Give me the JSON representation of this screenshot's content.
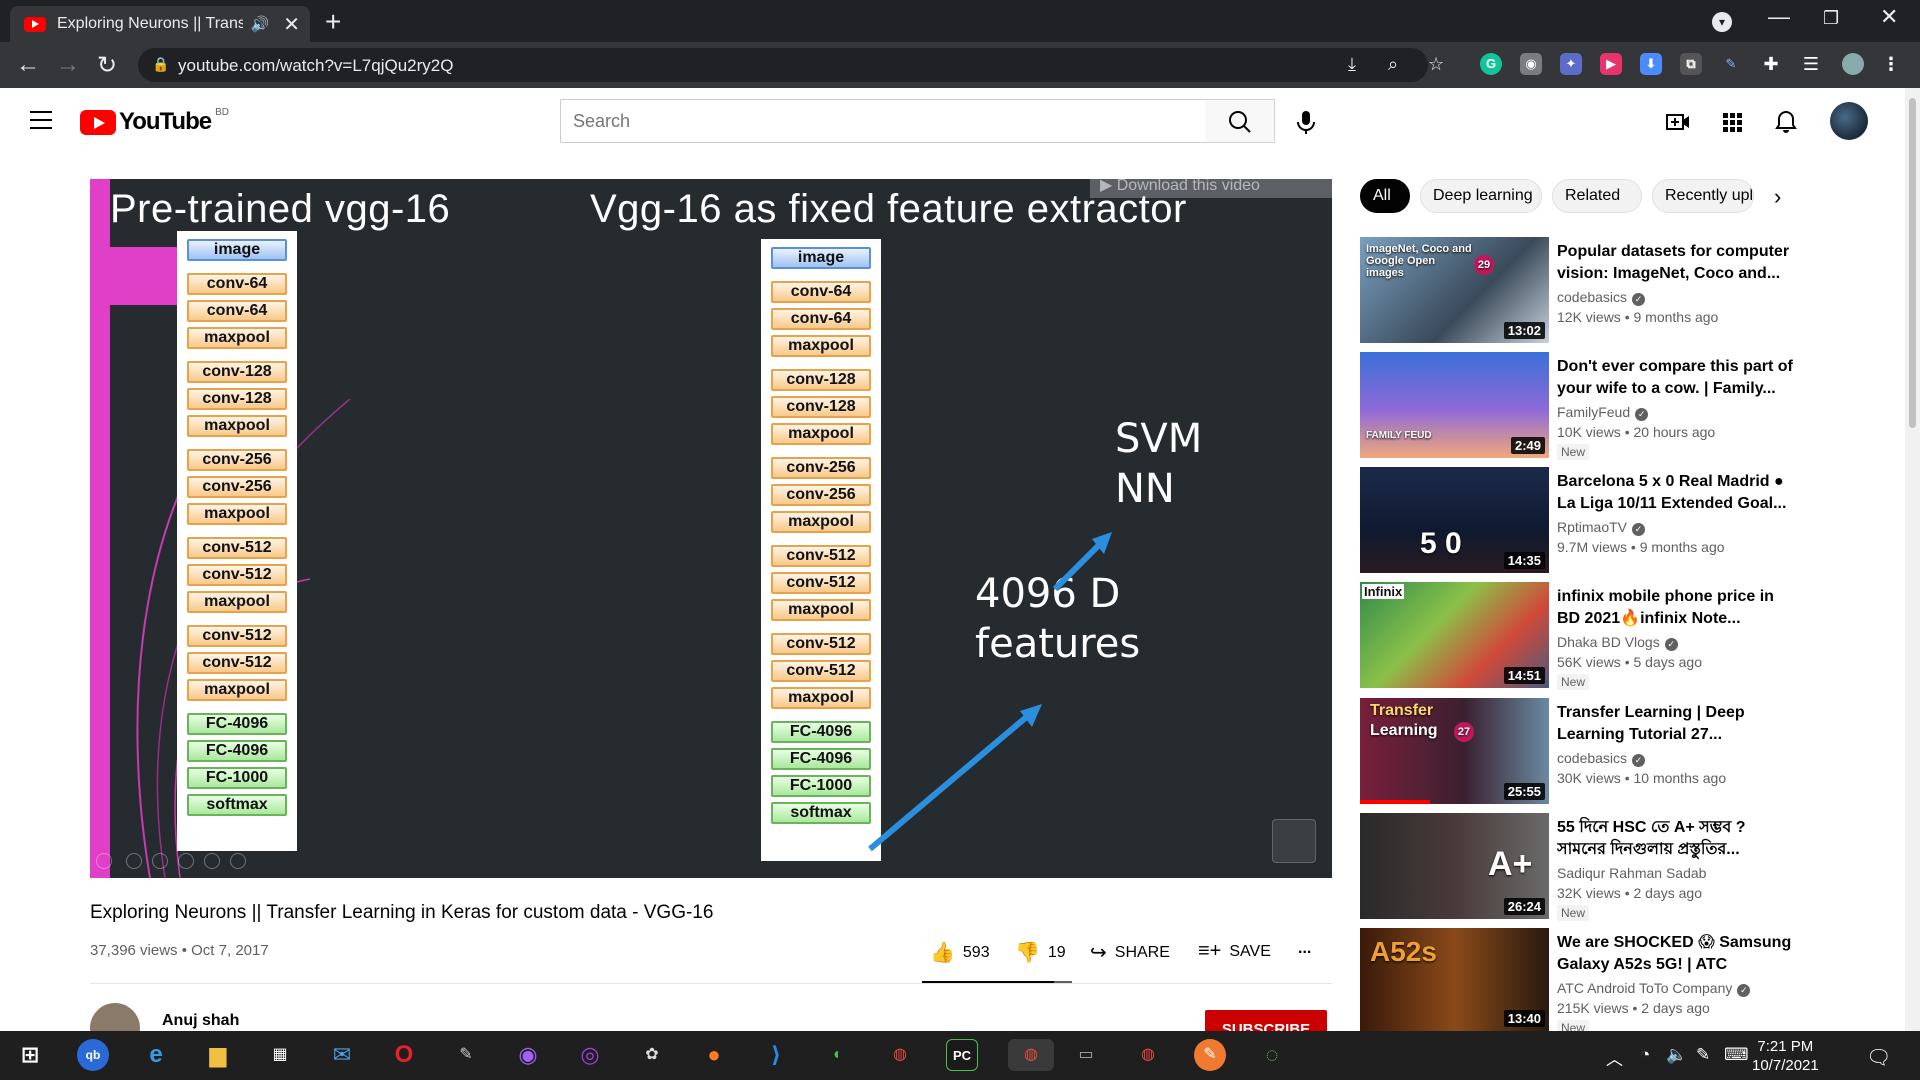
{
  "browser": {
    "tab_title": "Exploring Neurons || Transfer",
    "url": "youtube.com/watch?v=L7qjQu2ry2Q"
  },
  "header": {
    "logo_text": "YouTube",
    "country_code": "BD",
    "search_placeholder": "Search"
  },
  "player": {
    "slide_left_title": "Pre-trained vgg-16",
    "slide_right_title": "Vgg-16 as fixed feature extractor",
    "layers": [
      "image",
      "conv-64",
      "conv-64",
      "maxpool",
      "conv-128",
      "conv-128",
      "maxpool",
      "conv-256",
      "conv-256",
      "maxpool",
      "conv-512",
      "conv-512",
      "maxpool",
      "conv-512",
      "conv-512",
      "maxpool",
      "FC-4096",
      "FC-4096",
      "FC-1000",
      "softmax"
    ],
    "right_layers": [
      "image",
      "conv-64",
      "conv-64",
      "maxpool",
      "conv-128",
      "conv-128",
      "maxpool",
      "conv-256",
      "conv-256",
      "maxpool",
      "conv-512",
      "conv-512",
      "maxpool",
      "conv-512",
      "conv-512",
      "maxpool",
      "FC-4096",
      "FC-4096",
      "FC-1000",
      "softmax"
    ],
    "classifier_text_1": "SVM",
    "classifier_text_2": "NN",
    "features_text_1": "4096 D",
    "features_text_2": "features",
    "download_badge": "Download this video"
  },
  "video": {
    "title": "Exploring Neurons || Transfer Learning in Keras for custom data - VGG-16",
    "views_date": "37,396 views • Oct 7, 2017",
    "likes": "593",
    "dislikes": "19",
    "share_label": "SHARE",
    "save_label": "SAVE",
    "more_label": "...",
    "channel_name": "Anuj shah",
    "subscribe_label": "SUBSCRIBE"
  },
  "chips": [
    "All",
    "Deep learning",
    "Related",
    "Recently uploaded"
  ],
  "recommendations": [
    {
      "title": "Popular datasets for computer vision: ImageNet, Coco and...",
      "channel": "codebasics",
      "meta": "12K views • 9 months ago",
      "duration": "13:02",
      "badge": ""
    },
    {
      "title": "Don't ever compare this part of your wife to a cow. | Family...",
      "channel": "FamilyFeud",
      "meta": "10K views • 20 hours ago",
      "duration": "2:49",
      "badge": "New"
    },
    {
      "title": "Barcelona 5 x 0 Real Madrid ● La Liga 10/11 Extended Goal...",
      "channel": "RptimaoTV",
      "meta": "9.7M views • 9 months ago",
      "duration": "14:35",
      "badge": ""
    },
    {
      "title": "infinix mobile phone price in BD 2021🔥infinix Note...",
      "channel": "Dhaka BD Vlogs",
      "meta": "56K views • 5 days ago",
      "duration": "14:51",
      "badge": "New"
    },
    {
      "title": "Transfer Learning | Deep Learning Tutorial 27...",
      "channel": "codebasics",
      "meta": "30K views • 10 months ago",
      "duration": "25:55",
      "badge": ""
    },
    {
      "title": "55 দিনে HSC তে A+ সম্ভব ? সামনের দিনগুলায় প্রস্তুতির...",
      "channel": "Sadiqur Rahman Sadab",
      "meta": "32K views • 2 days ago",
      "duration": "26:24",
      "badge": "New"
    },
    {
      "title": "We are SHOCKED 😱 Samsung Galaxy A52s 5G! | ATC",
      "channel": "ATC Android ToTo Company",
      "meta": "215K views • 2 days ago",
      "duration": "13:40",
      "badge": "New"
    }
  ],
  "thumb_labels": {
    "t1": "ImageNet, Coco and Google Open images",
    "t1_num": "29",
    "t2": "FAMILY FEUD",
    "t3_score": "5 0",
    "t4": "Infinix",
    "t5_a": "Transfer",
    "t5_b": "Learning",
    "t5_num": "27",
    "t6": "A+",
    "t7": "A52s"
  },
  "taskbar": {
    "time": "7:21 PM",
    "date": "10/7/2021"
  }
}
